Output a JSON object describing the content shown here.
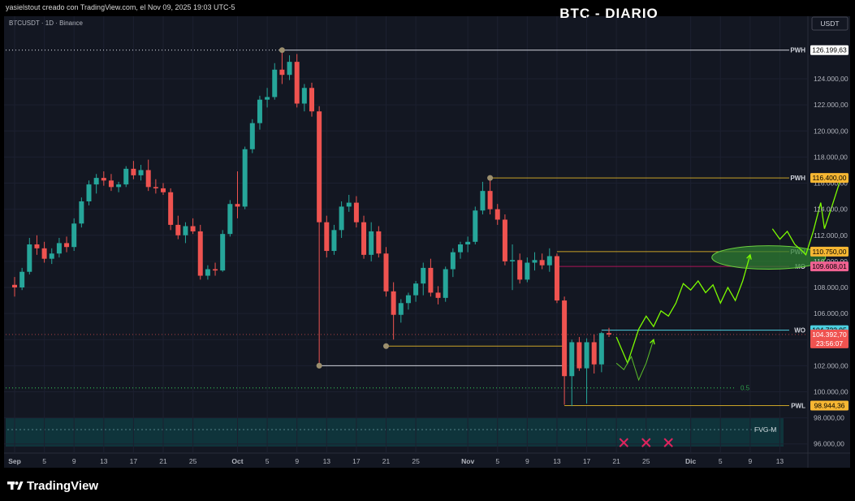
{
  "header": {
    "creator_line": "yasielstout creado con TradingView.com, el Nov 09, 2025 19:03 UTC-5",
    "symbol_line": "BTCUSDT · 1D · Binance",
    "chart_title": "BTC - DIARIO",
    "currency_badge": "USDT"
  },
  "footer": {
    "brand": "TradingView",
    "logo_icon": "tradingview-logo-icon"
  },
  "colors": {
    "up": "#26a69a",
    "down": "#ef5350",
    "background": "#131722",
    "projection": "#7cfc00",
    "zone": "#2e7d32",
    "fvg": "#0f3a40",
    "cross": "#e0245e"
  },
  "chart_data": {
    "type": "candlestick",
    "symbol": "BTCUSDT",
    "interval": "1D",
    "exchange": "Binance",
    "ylim": [
      94800,
      127800
    ],
    "y_ticks": [
      "96.000,00",
      "98.000,00",
      "100.000,00",
      "102.000,00",
      "104.000,00",
      "106.000,00",
      "108.000,00",
      "110.000,00",
      "112.000,00",
      "114.000,00",
      "116.000,00",
      "118.000,00",
      "120.000,00",
      "122.000,00",
      "124.000,00"
    ],
    "y_tick_values": [
      96000,
      98000,
      100000,
      102000,
      104000,
      106000,
      108000,
      110000,
      112000,
      114000,
      116000,
      118000,
      120000,
      122000,
      124000
    ],
    "x_ticks": [
      "Sep",
      "5",
      "9",
      "13",
      "17",
      "21",
      "25",
      "Oct",
      "5",
      "9",
      "13",
      "17",
      "21",
      "25",
      "Nov",
      "5",
      "9",
      "13",
      "17",
      "21",
      "25",
      "Dic",
      "5",
      "9",
      "13"
    ],
    "x_tick_days": [
      0,
      4,
      8,
      12,
      16,
      20,
      24,
      30,
      34,
      38,
      42,
      46,
      50,
      54,
      61,
      65,
      69,
      73,
      77,
      81,
      85,
      91,
      95,
      99,
      103
    ],
    "candles": [
      {
        "d": 0,
        "o": 108200,
        "h": 108800,
        "l": 107300,
        "c": 108000
      },
      {
        "d": 1,
        "o": 108000,
        "h": 109500,
        "l": 107800,
        "c": 109200
      },
      {
        "d": 2,
        "o": 109200,
        "h": 111800,
        "l": 109000,
        "c": 111300
      },
      {
        "d": 3,
        "o": 111300,
        "h": 112000,
        "l": 110500,
        "c": 111000
      },
      {
        "d": 4,
        "o": 111000,
        "h": 111500,
        "l": 109900,
        "c": 110200
      },
      {
        "d": 5,
        "o": 110200,
        "h": 111000,
        "l": 109800,
        "c": 110600
      },
      {
        "d": 6,
        "o": 110600,
        "h": 111800,
        "l": 110300,
        "c": 111400
      },
      {
        "d": 7,
        "o": 111400,
        "h": 111900,
        "l": 110700,
        "c": 111100
      },
      {
        "d": 8,
        "o": 111100,
        "h": 113300,
        "l": 110800,
        "c": 112900
      },
      {
        "d": 9,
        "o": 112900,
        "h": 114900,
        "l": 112600,
        "c": 114600
      },
      {
        "d": 10,
        "o": 114600,
        "h": 116200,
        "l": 114300,
        "c": 115900
      },
      {
        "d": 11,
        "o": 115900,
        "h": 116700,
        "l": 115200,
        "c": 116400
      },
      {
        "d": 12,
        "o": 116400,
        "h": 116900,
        "l": 115800,
        "c": 116200
      },
      {
        "d": 13,
        "o": 116200,
        "h": 116700,
        "l": 115400,
        "c": 115700
      },
      {
        "d": 14,
        "o": 115700,
        "h": 116100,
        "l": 115300,
        "c": 115900
      },
      {
        "d": 15,
        "o": 115900,
        "h": 117300,
        "l": 115700,
        "c": 117100
      },
      {
        "d": 16,
        "o": 117100,
        "h": 117700,
        "l": 116300,
        "c": 116600
      },
      {
        "d": 17,
        "o": 116600,
        "h": 117400,
        "l": 116200,
        "c": 117000
      },
      {
        "d": 18,
        "o": 117000,
        "h": 117800,
        "l": 115400,
        "c": 115700
      },
      {
        "d": 19,
        "o": 115700,
        "h": 116300,
        "l": 115200,
        "c": 115600
      },
      {
        "d": 20,
        "o": 115600,
        "h": 116000,
        "l": 115100,
        "c": 115300
      },
      {
        "d": 21,
        "o": 115300,
        "h": 115600,
        "l": 112400,
        "c": 112800
      },
      {
        "d": 22,
        "o": 112800,
        "h": 113500,
        "l": 111700,
        "c": 112000
      },
      {
        "d": 23,
        "o": 112000,
        "h": 113000,
        "l": 111400,
        "c": 112700
      },
      {
        "d": 24,
        "o": 112700,
        "h": 113300,
        "l": 112100,
        "c": 112300
      },
      {
        "d": 25,
        "o": 112300,
        "h": 112800,
        "l": 108600,
        "c": 108900
      },
      {
        "d": 26,
        "o": 108900,
        "h": 109700,
        "l": 108600,
        "c": 109400
      },
      {
        "d": 27,
        "o": 109400,
        "h": 109900,
        "l": 108900,
        "c": 109300
      },
      {
        "d": 28,
        "o": 109300,
        "h": 112400,
        "l": 109200,
        "c": 112100
      },
      {
        "d": 29,
        "o": 112100,
        "h": 114700,
        "l": 111900,
        "c": 114400
      },
      {
        "d": 30,
        "o": 114400,
        "h": 116900,
        "l": 113300,
        "c": 114200
      },
      {
        "d": 31,
        "o": 114200,
        "h": 118800,
        "l": 114000,
        "c": 118600
      },
      {
        "d": 32,
        "o": 118600,
        "h": 120900,
        "l": 118300,
        "c": 120600
      },
      {
        "d": 33,
        "o": 120600,
        "h": 122700,
        "l": 120100,
        "c": 122400
      },
      {
        "d": 34,
        "o": 122400,
        "h": 123300,
        "l": 121800,
        "c": 122600
      },
      {
        "d": 35,
        "o": 122600,
        "h": 125200,
        "l": 122400,
        "c": 124700
      },
      {
        "d": 36,
        "o": 124700,
        "h": 126200,
        "l": 123600,
        "c": 124300
      },
      {
        "d": 37,
        "o": 124300,
        "h": 125800,
        "l": 123900,
        "c": 125300
      },
      {
        "d": 38,
        "o": 125300,
        "h": 125900,
        "l": 121800,
        "c": 122100
      },
      {
        "d": 39,
        "o": 122100,
        "h": 123600,
        "l": 121500,
        "c": 123300
      },
      {
        "d": 40,
        "o": 123300,
        "h": 123700,
        "l": 121100,
        "c": 121500
      },
      {
        "d": 41,
        "o": 121500,
        "h": 121900,
        "l": 102000,
        "c": 113000
      },
      {
        "d": 42,
        "o": 113000,
        "h": 113500,
        "l": 110300,
        "c": 110800
      },
      {
        "d": 43,
        "o": 110800,
        "h": 112800,
        "l": 110500,
        "c": 112400
      },
      {
        "d": 44,
        "o": 112400,
        "h": 114600,
        "l": 111800,
        "c": 114200
      },
      {
        "d": 45,
        "o": 114200,
        "h": 115100,
        "l": 113800,
        "c": 114500
      },
      {
        "d": 46,
        "o": 114500,
        "h": 115000,
        "l": 112600,
        "c": 113000
      },
      {
        "d": 47,
        "o": 113000,
        "h": 113500,
        "l": 110200,
        "c": 110500
      },
      {
        "d": 48,
        "o": 110500,
        "h": 113000,
        "l": 110000,
        "c": 112300
      },
      {
        "d": 49,
        "o": 112300,
        "h": 112700,
        "l": 110300,
        "c": 110600
      },
      {
        "d": 50,
        "o": 110600,
        "h": 111100,
        "l": 107300,
        "c": 107700
      },
      {
        "d": 51,
        "o": 107700,
        "h": 108400,
        "l": 104000,
        "c": 105900
      },
      {
        "d": 52,
        "o": 105900,
        "h": 107100,
        "l": 105300,
        "c": 106800
      },
      {
        "d": 53,
        "o": 106800,
        "h": 107600,
        "l": 106300,
        "c": 107400
      },
      {
        "d": 54,
        "o": 107400,
        "h": 108500,
        "l": 106900,
        "c": 108300
      },
      {
        "d": 55,
        "o": 108300,
        "h": 109900,
        "l": 107400,
        "c": 109500
      },
      {
        "d": 56,
        "o": 109500,
        "h": 110200,
        "l": 107300,
        "c": 107600
      },
      {
        "d": 57,
        "o": 107600,
        "h": 108100,
        "l": 106700,
        "c": 107200
      },
      {
        "d": 58,
        "o": 107200,
        "h": 109600,
        "l": 106900,
        "c": 109400
      },
      {
        "d": 59,
        "o": 109400,
        "h": 111000,
        "l": 108800,
        "c": 110700
      },
      {
        "d": 60,
        "o": 110700,
        "h": 111500,
        "l": 110200,
        "c": 111300
      },
      {
        "d": 61,
        "o": 111300,
        "h": 111900,
        "l": 110700,
        "c": 111500
      },
      {
        "d": 62,
        "o": 111500,
        "h": 114200,
        "l": 111300,
        "c": 113900
      },
      {
        "d": 63,
        "o": 113900,
        "h": 116100,
        "l": 113600,
        "c": 115400
      },
      {
        "d": 64,
        "o": 115400,
        "h": 116400,
        "l": 113600,
        "c": 114000
      },
      {
        "d": 65,
        "o": 114000,
        "h": 114400,
        "l": 112800,
        "c": 113200
      },
      {
        "d": 66,
        "o": 113200,
        "h": 113600,
        "l": 109700,
        "c": 110000
      },
      {
        "d": 67,
        "o": 110000,
        "h": 111300,
        "l": 107800,
        "c": 110100
      },
      {
        "d": 68,
        "o": 110100,
        "h": 110600,
        "l": 108300,
        "c": 108600
      },
      {
        "d": 69,
        "o": 108600,
        "h": 110300,
        "l": 108400,
        "c": 109900
      },
      {
        "d": 70,
        "o": 109900,
        "h": 110700,
        "l": 109300,
        "c": 110100
      },
      {
        "d": 71,
        "o": 110100,
        "h": 110600,
        "l": 109400,
        "c": 109700
      },
      {
        "d": 72,
        "o": 109700,
        "h": 111000,
        "l": 109200,
        "c": 110400
      },
      {
        "d": 73,
        "o": 110400,
        "h": 110600,
        "l": 106800,
        "c": 107000
      },
      {
        "d": 74,
        "o": 107000,
        "h": 107300,
        "l": 99000,
        "c": 101200
      },
      {
        "d": 75,
        "o": 101200,
        "h": 104000,
        "l": 98900,
        "c": 103800
      },
      {
        "d": 76,
        "o": 103800,
        "h": 104200,
        "l": 101600,
        "c": 101800
      },
      {
        "d": 77,
        "o": 101800,
        "h": 104100,
        "l": 99100,
        "c": 103800
      },
      {
        "d": 78,
        "o": 103800,
        "h": 104400,
        "l": 101400,
        "c": 102100
      },
      {
        "d": 79,
        "o": 102100,
        "h": 104600,
        "l": 101500,
        "c": 104500
      },
      {
        "d": 80,
        "o": 104500,
        "h": 104900,
        "l": 104200,
        "c": 104393
      }
    ],
    "levels": [
      {
        "label": "PWH",
        "price": 126199.63,
        "tag": "126.199,63",
        "color": "#d1d4dc",
        "tag_bg": "#ffffff",
        "tag_fg": "#000000",
        "from_day": 36,
        "style": "solid"
      },
      {
        "label": "PWH",
        "price": 116400.0,
        "tag": "116.400,00",
        "color": "#c9a227",
        "tag_bg": "#f7b733",
        "tag_fg": "#000000",
        "from_day": 64,
        "style": "solid"
      },
      {
        "label": "PWH",
        "price": 110750.0,
        "tag": "110.750,00",
        "color": "#c9a227",
        "tag_bg": "#f7b733",
        "tag_fg": "#000000",
        "from_day": 73,
        "style": "solid"
      },
      {
        "label": "MO",
        "price": 109608.01,
        "tag": "109.608,01",
        "color": "#ad1457",
        "tag_bg": "#f06292",
        "tag_fg": "#000000",
        "from_day": 73,
        "style": "solid"
      },
      {
        "label": "WO",
        "price": 104722.95,
        "tag": "104.722,95",
        "color": "#4dd0e1",
        "tag_bg": "#4dd0e1",
        "tag_fg": "#000000",
        "from_day": 79,
        "style": "solid"
      },
      {
        "label": "PWL",
        "price": 98944.36,
        "tag": "98.944,36",
        "color": "#c9a227",
        "tag_bg": "#f7b733",
        "tag_fg": "#000000",
        "from_day": 74,
        "style": "solid"
      }
    ],
    "last_price": {
      "tag": "104.392,70",
      "countdown": "23:56:07",
      "price": 104392.7
    },
    "fvg": {
      "label": "FVG-M",
      "top": 98000,
      "bottom": 95800,
      "mid": 97100
    },
    "fib_line": {
      "label": "0.5",
      "price": 100300
    },
    "pivots": [
      {
        "d": 36,
        "price": 126199.63,
        "to_day": 117
      },
      {
        "d": 64,
        "price": 116400,
        "to_day": 117
      },
      {
        "d": 41,
        "price": 102000,
        "to_day": 74
      },
      {
        "d": 50,
        "price": 103500,
        "to_day": 74
      }
    ],
    "projection_main": [
      [
        81,
        104200
      ],
      [
        82.5,
        102200
      ],
      [
        84,
        104800
      ],
      [
        85,
        105800
      ],
      [
        86,
        105000
      ],
      [
        87,
        106200
      ],
      [
        88,
        105800
      ],
      [
        89,
        106800
      ],
      [
        90,
        108300
      ],
      [
        91,
        107800
      ],
      [
        92,
        108500
      ],
      [
        93,
        107600
      ],
      [
        94,
        108200
      ],
      [
        95,
        106800
      ],
      [
        96,
        108000
      ],
      [
        97,
        107000
      ],
      [
        98,
        108500
      ],
      [
        99,
        110500
      ]
    ],
    "projection_alt": [
      [
        102,
        112500
      ],
      [
        103,
        111700
      ],
      [
        104,
        112300
      ],
      [
        105,
        111300
      ],
      [
        106,
        110800
      ],
      [
        106.5,
        110500
      ],
      [
        107.5,
        112300
      ],
      [
        108.5,
        114500
      ],
      [
        109,
        112500
      ],
      [
        110,
        114200
      ],
      [
        111,
        116000
      ],
      [
        111.8,
        116600
      ]
    ],
    "projection_low": [
      [
        81,
        102200
      ],
      [
        82,
        101700
      ],
      [
        83,
        102700
      ],
      [
        84,
        100900
      ],
      [
        85,
        102200
      ],
      [
        86,
        104000
      ]
    ],
    "target_zone": {
      "center_day": 101.5,
      "price": 110300,
      "half_width_days": 4.5,
      "half_height_price": 900
    },
    "crosses_days": [
      82,
      85,
      88
    ],
    "cross_price": 96100
  }
}
